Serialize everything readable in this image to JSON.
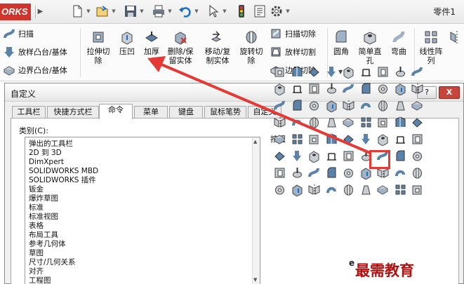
{
  "app": {
    "brand": "ORKS",
    "document_title": "零件1",
    "quick_access": [
      "new-icon",
      "open-icon",
      "save-icon",
      "print-icon",
      "undo-icon",
      "select-icon",
      "rebuild-icon",
      "file-properties-icon",
      "options-icon"
    ]
  },
  "ribbon": {
    "left_column": [
      "扫描",
      "放样凸台/基体",
      "边界凸台/基体"
    ],
    "big_buttons": [
      {
        "line1": "拉伸切",
        "line2": "除",
        "icon": "extruded-cut-icon"
      },
      {
        "line1": "压凹",
        "line2": "",
        "icon": "indent-icon"
      },
      {
        "line1": "加厚",
        "line2": "",
        "icon": "thicken-icon"
      },
      {
        "line1": "删除/保",
        "line2": "留实体",
        "icon": "delete-body-icon"
      },
      {
        "line1": "移动/复",
        "line2": "制实体",
        "icon": "move-copy-body-icon"
      },
      {
        "line1": "旋转切",
        "line2": "除",
        "icon": "revolved-cut-icon"
      }
    ],
    "cut_column": [
      "扫描切除",
      "放样切割",
      "边界切除"
    ],
    "right_buttons": [
      {
        "line1": "圆角",
        "line2": "",
        "icon": "fillet-icon"
      },
      {
        "line1": "简单直",
        "line2": "孔",
        "icon": "simple-hole-icon"
      },
      {
        "line1": "弯曲",
        "line2": "",
        "icon": "flex-icon"
      },
      {
        "line1": "线性阵",
        "line2": "列",
        "icon": "linear-pattern-icon"
      }
    ]
  },
  "dialog": {
    "title": "自定义",
    "help_label": "?",
    "close_label": "X",
    "tabs": [
      "工具栏",
      "快捷方式栏",
      "命令",
      "菜单",
      "键盘",
      "鼠标笔势",
      "自定义"
    ],
    "active_tab": "命令",
    "category_label": "类别(C):",
    "categories": [
      "弹出的工具栏",
      "2D 到 3D",
      "DimXpert",
      "SOLIDWORKS MBD",
      "SOLIDWORKS 插件",
      "钣金",
      "爆炸草图",
      "标准",
      "标准视图",
      "表格",
      "布局工具",
      "参考几何体",
      "草图",
      "尺寸/几何关系",
      "对齐",
      "工程图"
    ],
    "buttons_label": "按钮",
    "highlighted_button": "indent-icon"
  },
  "watermark": {
    "text": "最需教育",
    "mark": "e"
  },
  "colors": {
    "brand_red": "#d0342c",
    "close_red": "#c7463b",
    "annotation_red": "#e53935",
    "icon_blue": "#5b82a8",
    "icon_gray": "#c9ced4"
  }
}
